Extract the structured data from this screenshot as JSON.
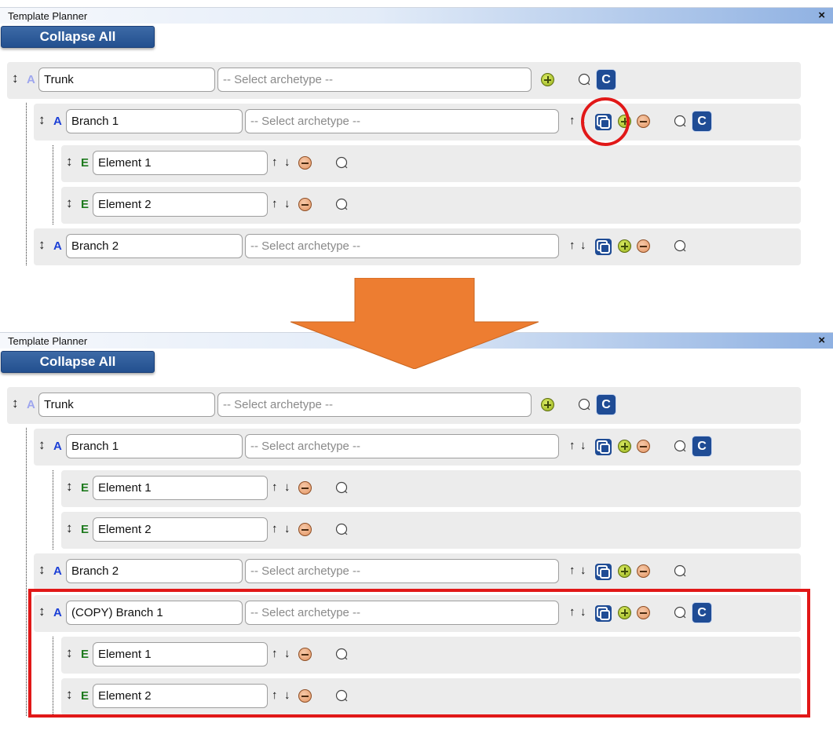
{
  "panels": [
    {
      "title": "Template Planner",
      "close": "×",
      "collapse_all": "Collapse All",
      "rows": [
        {
          "kind": "A",
          "value": "Trunk",
          "archetype": "-- Select archetype --"
        },
        {
          "kind": "A",
          "value": "Branch 1",
          "archetype": "-- Select archetype --",
          "up": "↑",
          "down": "↓"
        },
        {
          "kind": "E",
          "value": "Element 1",
          "up": "↑",
          "down": "↓"
        },
        {
          "kind": "E",
          "value": "Element 2",
          "up": "↑",
          "down": "↓"
        },
        {
          "kind": "A",
          "value": "Branch 2",
          "archetype": "-- Select archetype --",
          "up": "↑",
          "down": "↓"
        }
      ],
      "c_label": "C",
      "drag_glyph": "↕"
    },
    {
      "title": "Template Planner",
      "close": "×",
      "collapse_all": "Collapse All",
      "rows": [
        {
          "kind": "A",
          "value": "Trunk",
          "archetype": "-- Select archetype --"
        },
        {
          "kind": "A",
          "value": "Branch 1",
          "archetype": "-- Select archetype --",
          "up": "↑",
          "down": "↓"
        },
        {
          "kind": "E",
          "value": "Element 1",
          "up": "↑",
          "down": "↓"
        },
        {
          "kind": "E",
          "value": "Element 2",
          "up": "↑",
          "down": "↓"
        },
        {
          "kind": "A",
          "value": "Branch 2",
          "archetype": "-- Select archetype --",
          "up": "↑",
          "down": "↓"
        },
        {
          "kind": "A",
          "value": "(COPY) Branch 1",
          "archetype": "-- Select archetype --",
          "up": "↑",
          "down": "↓"
        },
        {
          "kind": "E",
          "value": "Element 1",
          "up": "↑",
          "down": "↓"
        },
        {
          "kind": "E",
          "value": "Element 2",
          "up": "↑",
          "down": "↓"
        }
      ],
      "c_label": "C",
      "drag_glyph": "↕"
    }
  ],
  "colors": {
    "arrow": "#ed7d31",
    "highlight": "#e11818",
    "c_button": "#1f4c95",
    "row_bg": "#ececec"
  },
  "icons": [
    "drag-handle-icon",
    "copy-icon",
    "add-icon",
    "remove-icon",
    "comment-icon"
  ]
}
